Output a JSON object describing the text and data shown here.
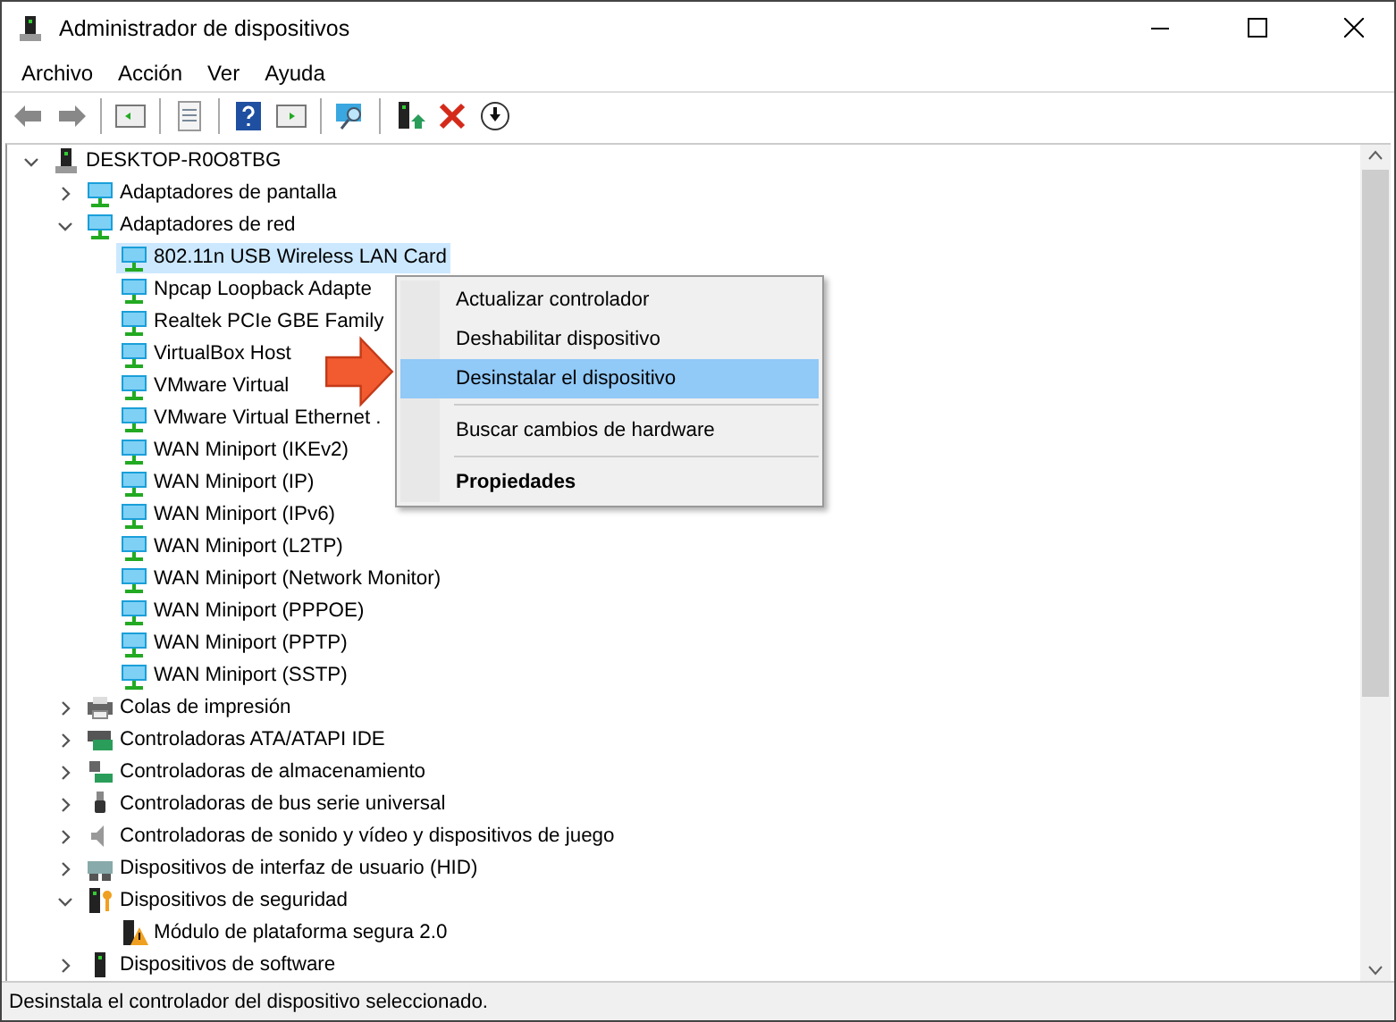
{
  "window": {
    "title": "Administrador de dispositivos"
  },
  "menu": [
    "Archivo",
    "Acción",
    "Ver",
    "Ayuda"
  ],
  "toolbar": [
    {
      "kind": "back"
    },
    {
      "kind": "forward"
    },
    {
      "kind": "sep"
    },
    {
      "kind": "panel-left"
    },
    {
      "kind": "sep"
    },
    {
      "kind": "properties"
    },
    {
      "kind": "sep"
    },
    {
      "kind": "help"
    },
    {
      "kind": "panel-right"
    },
    {
      "kind": "sep"
    },
    {
      "kind": "scan"
    },
    {
      "kind": "sep"
    },
    {
      "kind": "update"
    },
    {
      "kind": "remove"
    },
    {
      "kind": "download"
    }
  ],
  "tree": [
    {
      "label": "DESKTOP-R0O8TBG",
      "kind": "computer",
      "expanded": true,
      "selected": false,
      "children": [
        {
          "label": "Adaptadores de pantalla",
          "kind": "display",
          "expanded": false,
          "selected": false
        },
        {
          "label": "Adaptadores de red",
          "kind": "network",
          "expanded": true,
          "selected": false,
          "children": [
            {
              "label": "802.11n USB Wireless LAN Card",
              "kind": "network",
              "selected": true
            },
            {
              "label": "Npcap Loopback Adapte",
              "kind": "network",
              "selected": false
            },
            {
              "label": "Realtek PCIe GBE Family",
              "kind": "network",
              "selected": false
            },
            {
              "label": "VirtualBox Host",
              "kind": "network",
              "selected": false
            },
            {
              "label": "VMware Virtual",
              "kind": "network",
              "selected": false
            },
            {
              "label": "VMware Virtual Ethernet .",
              "kind": "network",
              "selected": false
            },
            {
              "label": "WAN Miniport (IKEv2)",
              "kind": "network",
              "selected": false
            },
            {
              "label": "WAN Miniport (IP)",
              "kind": "network",
              "selected": false
            },
            {
              "label": "WAN Miniport (IPv6)",
              "kind": "network",
              "selected": false
            },
            {
              "label": "WAN Miniport (L2TP)",
              "kind": "network",
              "selected": false
            },
            {
              "label": "WAN Miniport (Network Monitor)",
              "kind": "network",
              "selected": false
            },
            {
              "label": "WAN Miniport (PPPOE)",
              "kind": "network",
              "selected": false
            },
            {
              "label": "WAN Miniport (PPTP)",
              "kind": "network",
              "selected": false
            },
            {
              "label": "WAN Miniport (SSTP)",
              "kind": "network",
              "selected": false
            }
          ]
        },
        {
          "label": "Colas de impresión",
          "kind": "printer",
          "expanded": false,
          "selected": false
        },
        {
          "label": "Controladoras ATA/ATAPI IDE",
          "kind": "ide",
          "expanded": false,
          "selected": false
        },
        {
          "label": "Controladoras de almacenamiento",
          "kind": "storage",
          "expanded": false,
          "selected": false
        },
        {
          "label": "Controladoras de bus serie universal",
          "kind": "usb",
          "expanded": false,
          "selected": false
        },
        {
          "label": "Controladoras de sonido y vídeo y dispositivos de juego",
          "kind": "speaker",
          "expanded": false,
          "selected": false
        },
        {
          "label": "Dispositivos de interfaz de usuario (HID)",
          "kind": "hid",
          "expanded": false,
          "selected": false
        },
        {
          "label": "Dispositivos de seguridad",
          "kind": "security",
          "expanded": true,
          "selected": false,
          "children": [
            {
              "label": "Módulo de plataforma segura 2.0",
              "kind": "warning",
              "selected": false
            }
          ]
        },
        {
          "label": "Dispositivos de software",
          "kind": "software",
          "expanded": false,
          "selected": false
        }
      ]
    }
  ],
  "context_menu": [
    {
      "kind": "item",
      "label": "Actualizar controlador",
      "selected": false
    },
    {
      "kind": "item",
      "label": "Deshabilitar dispositivo",
      "selected": false
    },
    {
      "kind": "item",
      "label": "Desinstalar el dispositivo",
      "selected": true
    },
    {
      "kind": "separator"
    },
    {
      "kind": "item",
      "label": "Buscar cambios de hardware",
      "selected": false
    },
    {
      "kind": "separator"
    },
    {
      "kind": "bold",
      "label": "Propiedades",
      "selected": false
    }
  ],
  "status_bar": "Desinstala el controlador del dispositivo seleccionado."
}
